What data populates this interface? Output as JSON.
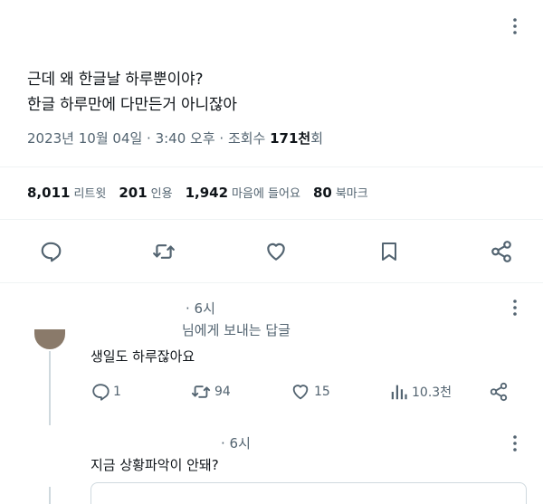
{
  "tweet": {
    "text_line1": "근데 왜 한글날 하루뿐이야?",
    "text_line2": "한글 하루만에 다만든거 아니잖아",
    "timestamp": "2023년 10월 04일 · 3:40 오후 · 조회수 ",
    "views": "171천",
    "views_suffix": "회"
  },
  "stats": {
    "retweets": "8,011",
    "retweets_label": "리트윗",
    "quotes": "201",
    "quotes_label": "인용",
    "likes": "1,942",
    "likes_label": "마음에 들어요",
    "bookmarks": "80",
    "bookmarks_label": "북마크"
  },
  "icons": {
    "reply": "reply-icon",
    "retweet": "retweet-icon",
    "like": "heart-icon",
    "bookmark": "bookmark-icon",
    "share": "share-icon",
    "more": "more-icon",
    "views": "bar-chart-icon"
  },
  "reply1": {
    "time": "· 6시",
    "replying_to": "님에게 보내는 답글",
    "text": "생일도 하루잖아요",
    "reply_count": "1",
    "retweet_count": "94",
    "like_count": "15",
    "view_count": "10.3천"
  },
  "reply2": {
    "time": "· 6시",
    "text": "지금 상황파악이 안돼?"
  },
  "colors": {
    "text": "#0f1419",
    "muted": "#536471",
    "border": "#eff3f4"
  }
}
